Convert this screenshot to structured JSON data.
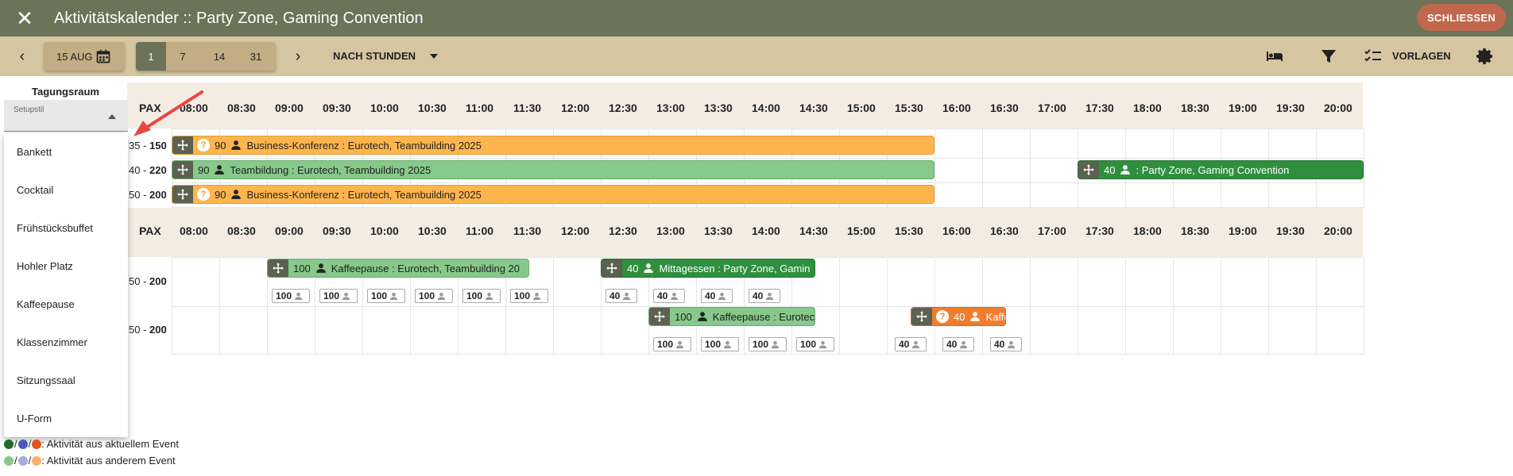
{
  "window": {
    "title": "Aktivitätskalender :: Party Zone, Gaming Convention",
    "close_button": "SCHLIESSEN"
  },
  "toolbar": {
    "date": "15 AUG",
    "range_options": [
      "1",
      "7",
      "14",
      "31"
    ],
    "range_selected": "1",
    "view_mode": "NACH STUNDEN",
    "templates_label": "VORLAGEN",
    "icons": [
      "chevron-left-icon",
      "calendar-icon",
      "chevron-right-icon",
      "caret-down-icon",
      "bed-icon",
      "filter-icon",
      "checklist-icon",
      "gear-icon"
    ]
  },
  "room_panel": {
    "title": "Tagungsraum",
    "setup_field_label": "Setupstil",
    "setup_options": [
      "Bankett",
      "Cocktail",
      "Frühstücksbuffet",
      "Hohler Platz",
      "Kaffeepause",
      "Klassenzimmer",
      "Sitzungssaal",
      "U-Form"
    ]
  },
  "grid": {
    "pax_header": "PAX",
    "times": [
      "08:00",
      "08:30",
      "09:00",
      "09:30",
      "10:00",
      "10:30",
      "11:00",
      "11:30",
      "12:00",
      "12:30",
      "13:00",
      "13:30",
      "14:00",
      "14:30",
      "15:00",
      "15:30",
      "16:00",
      "16:30",
      "17:00",
      "17:30",
      "18:00",
      "18:30",
      "19:00",
      "19:30",
      "20:00"
    ],
    "section1_rows": [
      {
        "pax_min": "35",
        "pax_max": "150"
      },
      {
        "pax_min": "40",
        "pax_max": "220"
      },
      {
        "pax_min": "50",
        "pax_max": "200"
      }
    ],
    "section2_rows": [
      {
        "pax_min": "50",
        "pax_max": "200"
      },
      {
        "pax_min": "50",
        "pax_max": "200"
      }
    ]
  },
  "bars": [
    {
      "pax": "90",
      "label": "Business-Konferenz : Eurotech, Teambuilding 2025",
      "status": "unconfirmed",
      "color": "#ffb54e"
    },
    {
      "pax": "90",
      "label": "Teambildung : Eurotech, Teambuilding 2025",
      "status": "confirmed",
      "color": "#86c98a"
    },
    {
      "pax": "40",
      "label": ": Party Zone, Gaming Convention",
      "status": "confirmed",
      "color": "#2f8f3f"
    },
    {
      "pax": "90",
      "label": "Business-Konferenz : Eurotech, Teambuilding 2025",
      "status": "unconfirmed",
      "color": "#ffb54e"
    },
    {
      "pax": "100",
      "label": "Kaffeepause : Eurotech, Teambuilding 20",
      "status": "confirmed",
      "color": "#86c98a"
    },
    {
      "pax": "40",
      "label": "Mittagessen : Party Zone, Gamin",
      "status": "confirmed",
      "color": "#2f8f3f"
    },
    {
      "pax": "100",
      "label": "Kaffeepause : Eurotec",
      "status": "confirmed",
      "color": "#86c98a"
    },
    {
      "pax": "40",
      "label": "Kaffe",
      "status": "unconfirmed",
      "color": "#f07d2e"
    }
  ],
  "chips": {
    "row1": [
      "100",
      "100",
      "100",
      "100",
      "100",
      "100",
      "40",
      "40",
      "40",
      "40"
    ],
    "row2": [
      "100",
      "100",
      "100",
      "100",
      "40",
      "40",
      "40"
    ]
  },
  "legend": {
    "current": ": Aktivität aus aktuellem Event",
    "other": ": Aktivität aus anderem Event",
    "current_colors": [
      "#1f6b2a",
      "#4a5bbf",
      "#e0531f"
    ],
    "other_colors": [
      "#86c98a",
      "#a7acd8",
      "#f7b26b"
    ]
  },
  "colors": {
    "title_bar": "#6b7358",
    "toolbar": "#d5c5a0",
    "close_button": "#c0674e",
    "header_row": "#f4ece3"
  }
}
